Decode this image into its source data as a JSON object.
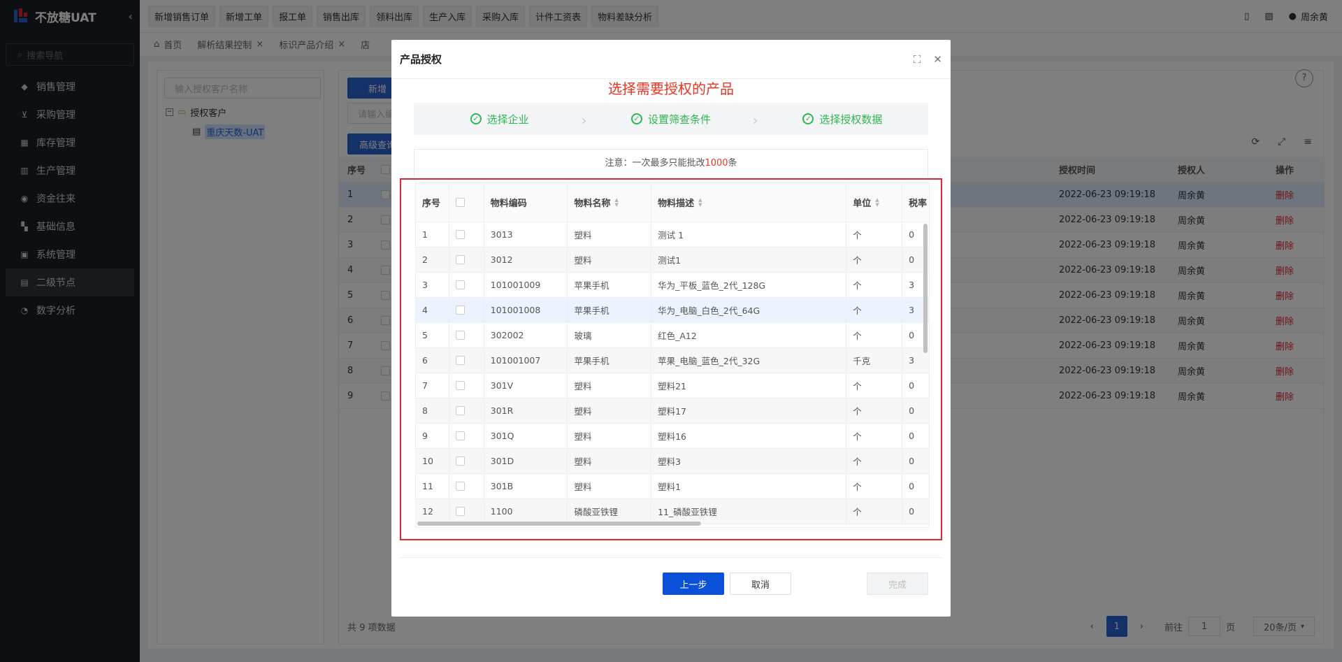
{
  "app": {
    "title": "不放糖UAT"
  },
  "sidebar": {
    "search_placeholder": "搜索导航",
    "items": [
      {
        "label": "销售管理",
        "icon": "tag-icon"
      },
      {
        "label": "采购管理",
        "icon": "cart-icon"
      },
      {
        "label": "库存管理",
        "icon": "inventory-icon"
      },
      {
        "label": "生产管理",
        "icon": "production-icon"
      },
      {
        "label": "资金往来",
        "icon": "money-icon"
      },
      {
        "label": "基础信息",
        "icon": "grid-icon"
      },
      {
        "label": "系统管理",
        "icon": "system-icon"
      },
      {
        "label": "二级节点",
        "icon": "node-icon"
      },
      {
        "label": "数字分析",
        "icon": "pie-icon"
      }
    ]
  },
  "topbar": {
    "quick_buttons": [
      "新增销售订单",
      "新增工单",
      "报工单",
      "销售出库",
      "领料出库",
      "生产入库",
      "采购入库",
      "计件工资表",
      "物料差缺分析"
    ],
    "user": "周余黄"
  },
  "tabs": [
    "首页",
    "解析结果控制",
    "标识产品介绍",
    "店"
  ],
  "tree": {
    "search_placeholder": "输入授权客户名称",
    "root_label": "授权客户",
    "child_label": "重庆天数-UAT"
  },
  "main": {
    "add_button": "新增",
    "code_placeholder": "请输入编码",
    "advanced_button": "高级查询",
    "table_headers": {
      "index": "序号",
      "auth_time": "授权时间",
      "auth_user": "授权人",
      "action": "操作"
    },
    "rows": [
      {
        "index": "1",
        "time": "2022-06-23 09:19:18",
        "user": "周余黄",
        "action": "删除"
      },
      {
        "index": "2",
        "time": "2022-06-23 09:19:18",
        "user": "周余黄",
        "action": "删除"
      },
      {
        "index": "3",
        "time": "2022-06-23 09:19:18",
        "user": "周余黄",
        "action": "删除"
      },
      {
        "index": "4",
        "time": "2022-06-23 09:19:18",
        "user": "周余黄",
        "action": "删除"
      },
      {
        "index": "5",
        "time": "2022-06-23 09:19:18",
        "user": "周余黄",
        "action": "删除"
      },
      {
        "index": "6",
        "time": "2022-06-23 09:19:18",
        "user": "周余黄",
        "action": "删除"
      },
      {
        "index": "7",
        "time": "2022-06-23 09:19:18",
        "user": "周余黄",
        "action": "删除"
      },
      {
        "index": "8",
        "time": "2022-06-23 09:19:18",
        "user": "周余黄",
        "action": "删除"
      },
      {
        "index": "9",
        "time": "2022-06-23 09:19:18",
        "user": "周余黄",
        "action": "删除"
      }
    ],
    "total": "共 9 项数据",
    "current_page": "1",
    "goto_label": "前往",
    "goto_value": "1",
    "page_suffix": "页",
    "page_size": "20条/页"
  },
  "modal": {
    "title": "产品授权",
    "annotation": "选择需要授权的产品",
    "steps": [
      "选择企业",
      "设置筛查条件",
      "选择授权数据"
    ],
    "notice_prefix": "注意：一次最多只能批改",
    "notice_number": "1000",
    "notice_suffix": "条",
    "columns": {
      "index": "序号",
      "code": "物料编码",
      "name": "物料名称",
      "desc": "物料描述",
      "unit": "单位",
      "tax": "税率"
    },
    "rows": [
      {
        "index": "1",
        "code": "3013",
        "name": "塑料",
        "desc": "测试 1",
        "unit": "个",
        "tax": "0"
      },
      {
        "index": "2",
        "code": "3012",
        "name": "塑料",
        "desc": "测试1",
        "unit": "个",
        "tax": "0"
      },
      {
        "index": "3",
        "code": "101001009",
        "name": "苹果手机",
        "desc": "华为_平板_蓝色_2代_128G",
        "unit": "个",
        "tax": "3"
      },
      {
        "index": "4",
        "code": "101001008",
        "name": "苹果手机",
        "desc": "华为_电脑_白色_2代_64G",
        "unit": "个",
        "tax": "3"
      },
      {
        "index": "5",
        "code": "302002",
        "name": "玻璃",
        "desc": "红色_A12",
        "unit": "个",
        "tax": "0"
      },
      {
        "index": "6",
        "code": "101001007",
        "name": "苹果手机",
        "desc": "苹果_电脑_蓝色_2代_32G",
        "unit": "千克",
        "tax": "3"
      },
      {
        "index": "7",
        "code": "301V",
        "name": "塑料",
        "desc": "塑料21",
        "unit": "个",
        "tax": "0"
      },
      {
        "index": "8",
        "code": "301R",
        "name": "塑料",
        "desc": "塑料17",
        "unit": "个",
        "tax": "0"
      },
      {
        "index": "9",
        "code": "301Q",
        "name": "塑料",
        "desc": "塑料16",
        "unit": "个",
        "tax": "0"
      },
      {
        "index": "10",
        "code": "301D",
        "name": "塑料",
        "desc": "塑料3",
        "unit": "个",
        "tax": "0"
      },
      {
        "index": "11",
        "code": "301B",
        "name": "塑料",
        "desc": "塑料1",
        "unit": "个",
        "tax": "0"
      },
      {
        "index": "12",
        "code": "1100",
        "name": "磷酸亚铁锂",
        "desc": "11_磷酸亚铁锂",
        "unit": "个",
        "tax": "0"
      }
    ],
    "buttons": {
      "prev": "上一步",
      "cancel": "取消",
      "finish": "完成"
    }
  },
  "colors": {
    "primary": "#2a63d4",
    "success": "#2db74f",
    "danger": "#e3272d",
    "sidebar": "#1b1e24"
  }
}
